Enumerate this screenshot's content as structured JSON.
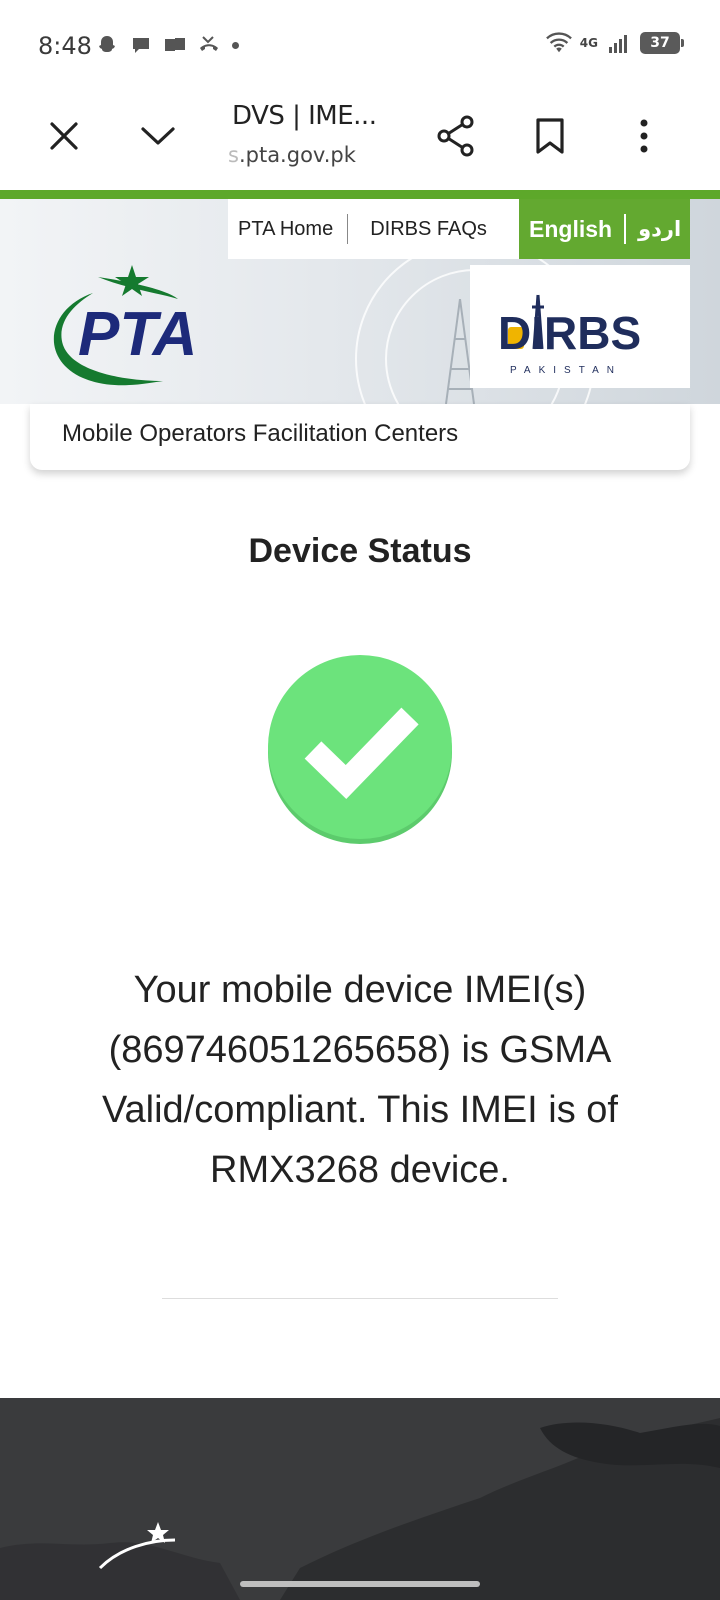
{
  "status_bar": {
    "time": "8:48",
    "network": "4G",
    "battery": "37"
  },
  "browser": {
    "title": "DVS | IME...",
    "url_faded": "s",
    "url": ".pta.gov.pk"
  },
  "site_nav": {
    "home": "PTA Home",
    "faqs": "DIRBS FAQs",
    "lang_en": "English",
    "lang_ur": "اردو"
  },
  "logos": {
    "pta": "PTA",
    "dirbs": "DIRBS",
    "dirbs_sub": "PAKISTAN"
  },
  "card_link": "Mobile Operators Facilitation Centers",
  "main": {
    "heading": "Device Status",
    "message": "Your mobile device IMEI(s) (869746051265658) is GSMA Valid/compliant. This IMEI is of RMX3268 device."
  },
  "colors": {
    "accent_green": "#5da82a",
    "check_green": "#6ce37c",
    "pta_blue": "#1d2a7a",
    "pta_green": "#157a2f"
  }
}
